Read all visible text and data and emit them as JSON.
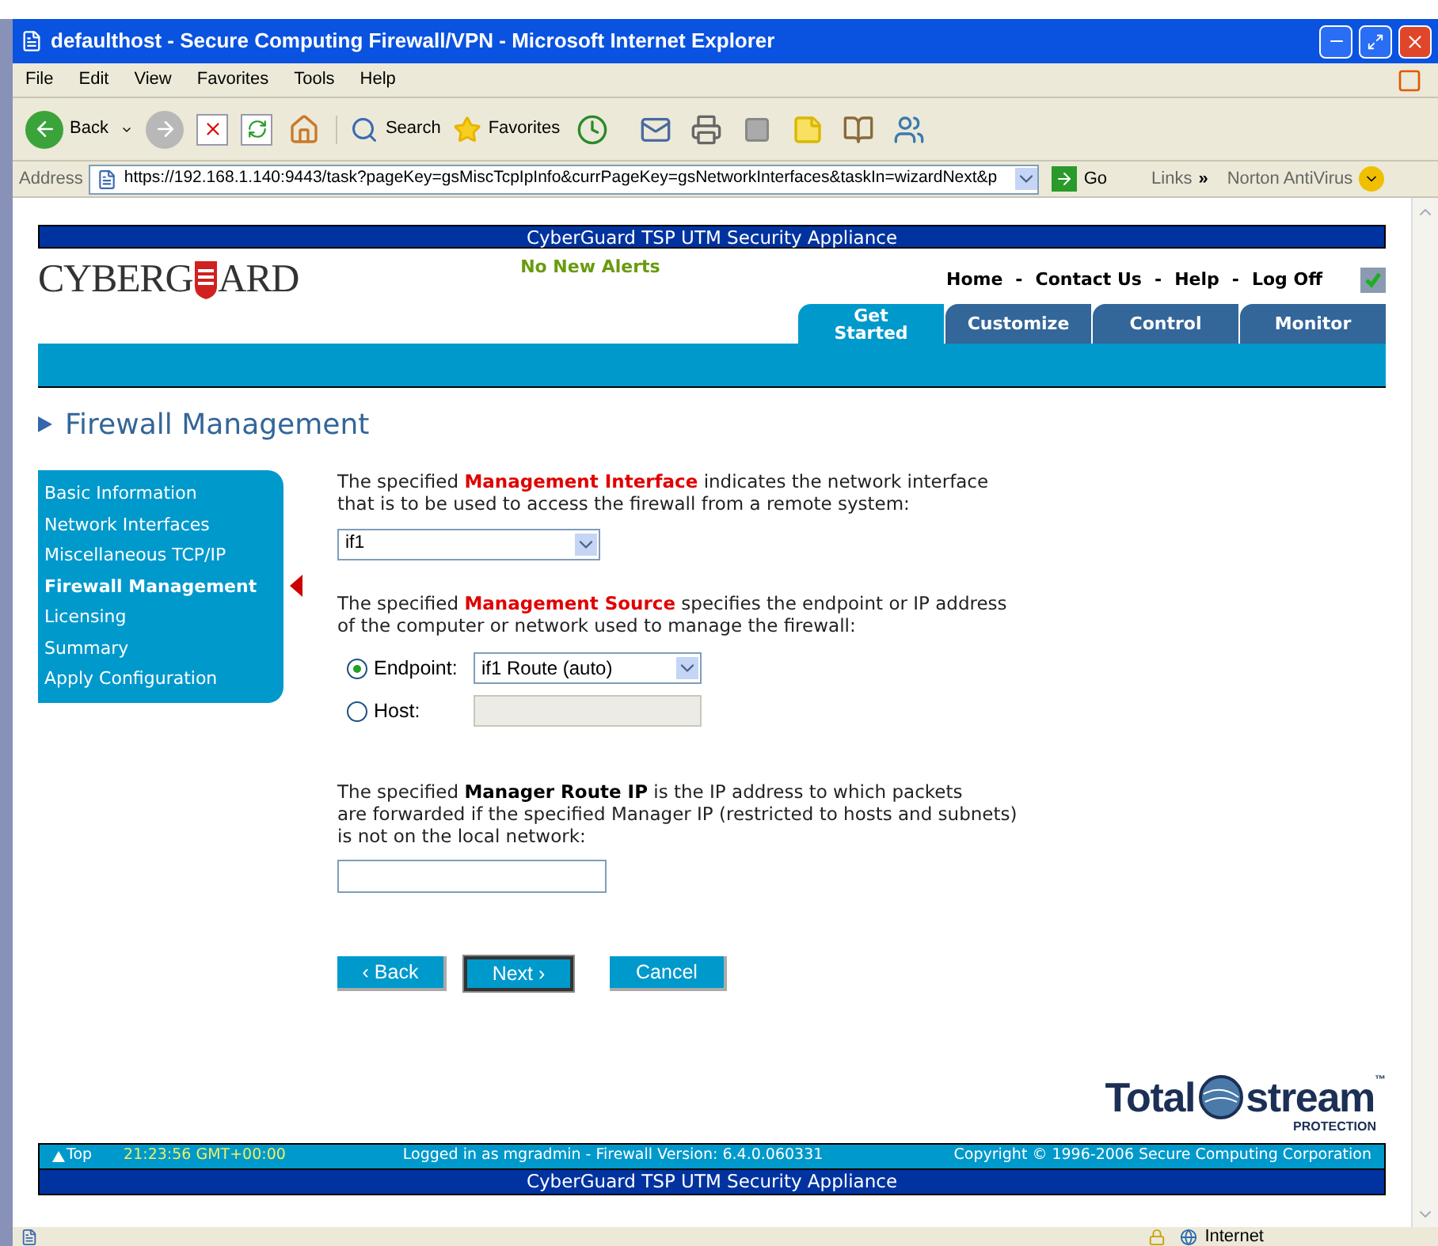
{
  "window": {
    "title": "defaulthost - Secure Computing Firewall/VPN - Microsoft Internet Explorer"
  },
  "menu": [
    "File",
    "Edit",
    "View",
    "Favorites",
    "Tools",
    "Help"
  ],
  "toolbar": {
    "back": "Back",
    "search": "Search",
    "favorites": "Favorites"
  },
  "address_bar": {
    "label": "Address",
    "url": "https://192.168.1.140:9443/task?pageKey=gsMiscTcpIpInfo&currPageKey=gsNetworkInterfaces&taskIn=wizardNext&p",
    "go": "Go",
    "links": "Links",
    "links_chevron": "»",
    "norton": "Norton AntiVirus"
  },
  "page": {
    "banner": "CyberGuard TSP UTM Security Appliance",
    "logo": {
      "left": "CYBERG",
      "right": "ARD"
    },
    "alerts": "No New Alerts",
    "top_links": [
      "Home",
      "Contact Us",
      "Help",
      "Log Off"
    ],
    "link_separator": "-",
    "tabs": [
      {
        "label": "Get Started",
        "selected": true
      },
      {
        "label": "Customize",
        "selected": false
      },
      {
        "label": "Control",
        "selected": false
      },
      {
        "label": "Monitor",
        "selected": false
      }
    ],
    "heading": "Firewall Management",
    "steps": [
      {
        "label": "Basic Information",
        "selected": false
      },
      {
        "label": "Network Interfaces",
        "selected": false
      },
      {
        "label": "Miscellaneous TCP/IP",
        "selected": false
      },
      {
        "label": "Firewall Management",
        "selected": true
      },
      {
        "label": "Licensing",
        "selected": false
      },
      {
        "label": "Summary",
        "selected": false
      },
      {
        "label": "Apply Configuration",
        "selected": false
      }
    ],
    "interface_text": "The specified **Management Interface** indicates the network interface\nthat is to be used to access the firewall from a remote system:",
    "interface_select": "if1",
    "source_text": "The specified **Management Source** specifies the endpoint or IP address\nof the computer or network used to manage the firewall:",
    "source_options": [
      {
        "label": "Endpoint:",
        "selected": true,
        "kind": "select",
        "value": "if1 Route (auto)"
      },
      {
        "label": "Host:",
        "selected": false,
        "kind": "field",
        "disabled": true
      }
    ],
    "route_text": "The specified **Manager Route IP** is the IP address to which packets\nare forwarded if the specified Manager IP (restricted to hosts and subnets)\nis not on the local network:",
    "emphasis_red": [
      true,
      true,
      false
    ],
    "buttons": [
      {
        "label": "‹ Back",
        "focused": false
      },
      {
        "label": "Next ›",
        "focused": true
      },
      {
        "label": "Cancel",
        "focused": false
      }
    ],
    "brand": {
      "left": "Total",
      "right": "stream",
      "tag": "PROTECTION",
      "tm": "™"
    },
    "footer": {
      "top": "Top",
      "time": "21:23:56 GMT+00:00",
      "login": "Logged in as mgradmin  - Firewall Version: 6.4.0.060331",
      "copyright": "Copyright © 1996-2006 Secure Computing Corporation",
      "banner": "CyberGuard TSP UTM Security Appliance"
    }
  },
  "status_bar": {
    "zone": "Internet"
  }
}
